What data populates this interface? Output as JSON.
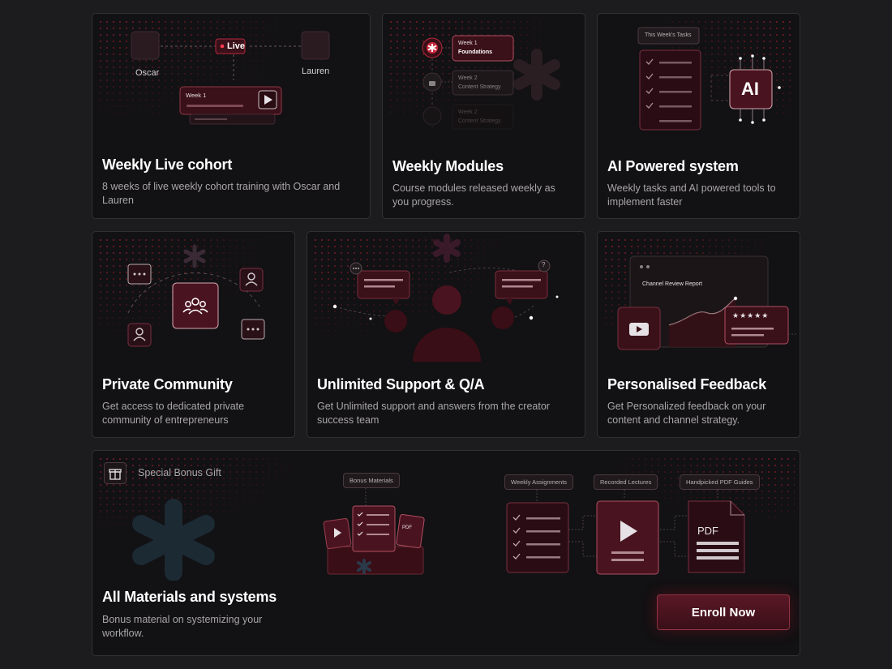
{
  "cards": {
    "cohort": {
      "title": "Weekly Live cohort",
      "desc": "8 weeks of live weekly cohort training with Oscar and Lauren",
      "host_left": "Oscar",
      "host_right": "Lauren",
      "live_badge": "Live",
      "week_label": "Week 1"
    },
    "modules": {
      "title": "Weekly Modules",
      "desc": "Course modules released weekly as you progress.",
      "items": [
        {
          "week": "Week 1",
          "topic": "Foundations"
        },
        {
          "week": "Week 2",
          "topic": "Content Strategy"
        },
        {
          "week": "Week 2",
          "topic": "Content Strategy"
        }
      ]
    },
    "ai": {
      "title": "AI Powered system",
      "desc": "Weekly tasks and AI powered tools to implement faster",
      "tasks_label": "This Week's Tasks",
      "ai_label": "AI"
    },
    "community": {
      "title": "Private Community",
      "desc": "Get access to dedicated private community of entrepreneurs"
    },
    "support": {
      "title": "Unlimited Support & Q/A",
      "desc": "Get Unlimited support and answers from the creator success team"
    },
    "feedback": {
      "title": "Personalised Feedback",
      "desc": "Get Personalized feedback on your content and channel strategy.",
      "report_label": "Channel Review Report"
    },
    "bonus": {
      "badge": "Special Bonus Gift",
      "title": "All Materials and systems",
      "desc": "Bonus material on systemizing your workflow.",
      "bonus_materials": "Bonus Materials",
      "weekly_assignments": "Weekly Assignments",
      "recorded_lectures": "Recorded Lectures",
      "pdf_guides": "Handpicked PDF Guides",
      "pdf_small": "PDF",
      "pdf_big": "PDF",
      "enroll": "Enroll Now"
    }
  },
  "colors": {
    "accent": "#8a1e30",
    "bg": "#1c1b1d",
    "card": "#121113"
  }
}
